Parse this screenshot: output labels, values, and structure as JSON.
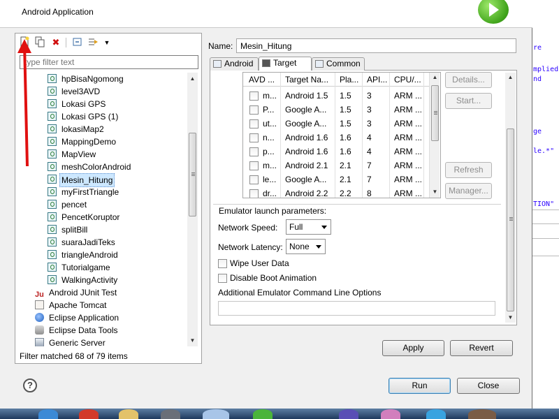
{
  "dialog": {
    "header_title": "Android Application"
  },
  "background_editor": {
    "snippets": [
      "re",
      "mplied",
      "nd",
      "ge",
      "le.*\"",
      "TION\""
    ]
  },
  "left_panel": {
    "toolbar_icons": [
      "new-launch-configuration-icon",
      "duplicate-icon",
      "delete-icon",
      "collapse-all-icon",
      "filter-icon",
      "dropdown-icon"
    ],
    "filter_placeholder": "type filter text",
    "tree_children": [
      "hpBisaNgomong",
      "level3AVD",
      "Lokasi GPS",
      "Lokasi GPS (1)",
      "lokasiMap2",
      "MappingDemo",
      "MapView",
      "meshColorAndroid",
      "Mesin_Hitung",
      "myFirstTriangle",
      "pencet",
      "PencetKoruptor",
      "splitBill",
      "suaraJadiTeks",
      "triangleAndroid",
      "Tutorialgame",
      "WalkingActivity"
    ],
    "selected_child": "Mesin_Hitung",
    "tree_roots": [
      {
        "label": "Android JUnit Test",
        "icon": "junit-icon"
      },
      {
        "label": "Apache Tomcat",
        "icon": "tomcat-icon"
      },
      {
        "label": "Eclipse Application",
        "icon": "eclipse-icon"
      },
      {
        "label": "Eclipse Data Tools",
        "icon": "database-icon"
      },
      {
        "label": "Generic Server",
        "icon": "server-icon"
      }
    ],
    "filter_status": "Filter matched 68 of 79 items"
  },
  "config": {
    "name_label": "Name:",
    "name_value": "Mesin_Hitung",
    "tabs": [
      {
        "label": "Android",
        "active": false
      },
      {
        "label": "Target",
        "active": true
      },
      {
        "label": "Common",
        "active": false
      }
    ],
    "avd_columns": [
      "AVD ...",
      "Target Na...",
      "Pla...",
      "API...",
      "CPU/..."
    ],
    "avd_rows": [
      [
        "m...",
        "Android 1.5",
        "1.5",
        "3",
        "ARM ..."
      ],
      [
        "P...",
        "Google A...",
        "1.5",
        "3",
        "ARM ..."
      ],
      [
        "ut...",
        "Google A...",
        "1.5",
        "3",
        "ARM ..."
      ],
      [
        "n...",
        "Android 1.6",
        "1.6",
        "4",
        "ARM ..."
      ],
      [
        "p...",
        "Android 1.6",
        "1.6",
        "4",
        "ARM ..."
      ],
      [
        "m...",
        "Android 2.1",
        "2.1",
        "7",
        "ARM ..."
      ],
      [
        "le...",
        "Google A...",
        "2.1",
        "7",
        "ARM ..."
      ],
      [
        "dr...",
        "Android 2.2",
        "2.2",
        "8",
        "ARM ..."
      ]
    ],
    "side_buttons": {
      "details": "Details...",
      "start": "Start...",
      "refresh": "Refresh",
      "manager": "Manager..."
    },
    "emulator": {
      "group_title": "Emulator launch parameters:",
      "network_speed_label": "Network Speed:",
      "network_speed_value": "Full",
      "network_latency_label": "Network Latency:",
      "network_latency_value": "None",
      "wipe_user_data": "Wipe User Data",
      "disable_boot_animation": "Disable Boot Animation",
      "additional_options_label": "Additional Emulator Command Line Options"
    },
    "apply": "Apply",
    "revert": "Revert"
  },
  "footer": {
    "run": "Run",
    "close": "Close",
    "help_icon": "help-icon"
  },
  "colors": {
    "accent_selection": "#cde8ff",
    "annotation_arrow": "#e01010",
    "delete_icon": "#d01010",
    "run_logo": "#3fa31a"
  }
}
